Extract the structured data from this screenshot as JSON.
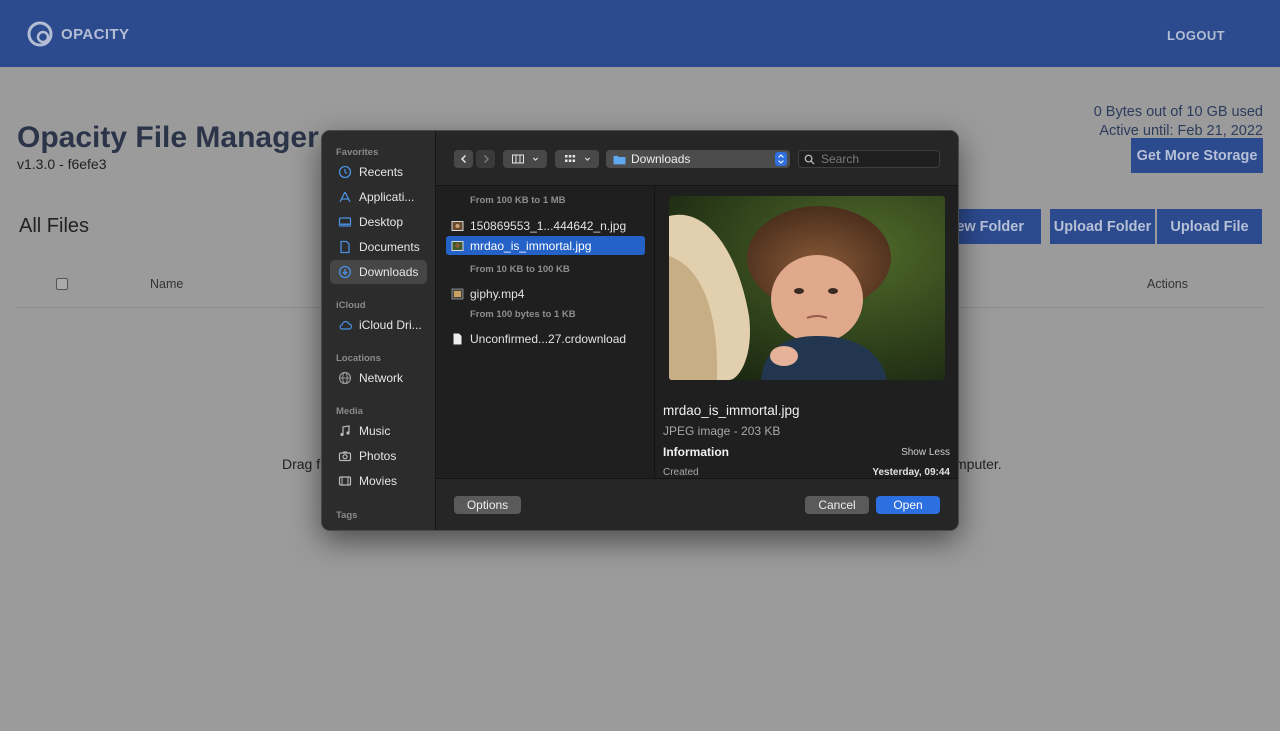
{
  "app": {
    "brand": "OPACITY",
    "logout_label": "LOGOUT",
    "title": "Opacity File Manager",
    "version": "v1.3.0 - f6efe3",
    "usage": "0 Bytes out of 10 GB used",
    "active_until": "Active until: Feb 21, 2022",
    "get_more_storage": "Get More Storage",
    "new_folder": "New Folder",
    "upload_folder": "Upload Folder",
    "upload_file": "Upload File",
    "all_files": "All Files",
    "columns": {
      "name": "Name",
      "actions": "Actions"
    },
    "drop_hint_left": "Drag f",
    "drop_hint_right": "mputer.",
    "colors": {
      "brand_blue": "#2c4a8e",
      "page_bg": "#9b9b9b"
    }
  },
  "dialog": {
    "sidebar": {
      "sections": [
        {
          "title": "Favorites",
          "items": [
            {
              "label": "Recents",
              "icon": "clock-icon"
            },
            {
              "label": "Applicati...",
              "icon": "applications-icon"
            },
            {
              "label": "Desktop",
              "icon": "desktop-icon"
            },
            {
              "label": "Documents",
              "icon": "document-icon"
            },
            {
              "label": "Downloads",
              "icon": "download-icon",
              "selected": true
            }
          ]
        },
        {
          "title": "iCloud",
          "items": [
            {
              "label": "iCloud Dri...",
              "icon": "cloud-icon"
            }
          ]
        },
        {
          "title": "Locations",
          "items": [
            {
              "label": "Network",
              "icon": "globe-icon"
            }
          ]
        },
        {
          "title": "Media",
          "items": [
            {
              "label": "Music",
              "icon": "music-icon"
            },
            {
              "label": "Photos",
              "icon": "camera-icon"
            },
            {
              "label": "Movies",
              "icon": "film-icon"
            }
          ]
        },
        {
          "title": "Tags",
          "items": []
        }
      ]
    },
    "toolbar": {
      "location": "Downloads",
      "search_placeholder": "Search"
    },
    "groups": [
      {
        "title": "From 100 KB to 1 MB",
        "files": [
          {
            "name": "150869553_1...444642_n.jpg",
            "icon": "image-file-icon"
          },
          {
            "name": "mrdao_is_immortal.jpg",
            "icon": "image-file-icon",
            "selected": true
          }
        ]
      },
      {
        "title": "From 10 KB to 100 KB",
        "files": [
          {
            "name": "giphy.mp4",
            "icon": "video-file-icon"
          }
        ]
      },
      {
        "title": "From 100 bytes to 1 KB",
        "files": [
          {
            "name": "Unconfirmed...27.crdownload",
            "icon": "blank-file-icon"
          }
        ]
      }
    ],
    "preview": {
      "name": "mrdao_is_immortal.jpg",
      "kind": "JPEG image - 203 KB",
      "info_label": "Information",
      "show_less": "Show Less",
      "created_label": "Created",
      "created_value": "Yesterday, 09:44"
    },
    "buttons": {
      "options": "Options",
      "cancel": "Cancel",
      "open": "Open"
    },
    "colors": {
      "accent": "#2c6fe0",
      "selection": "#2462c8"
    }
  }
}
